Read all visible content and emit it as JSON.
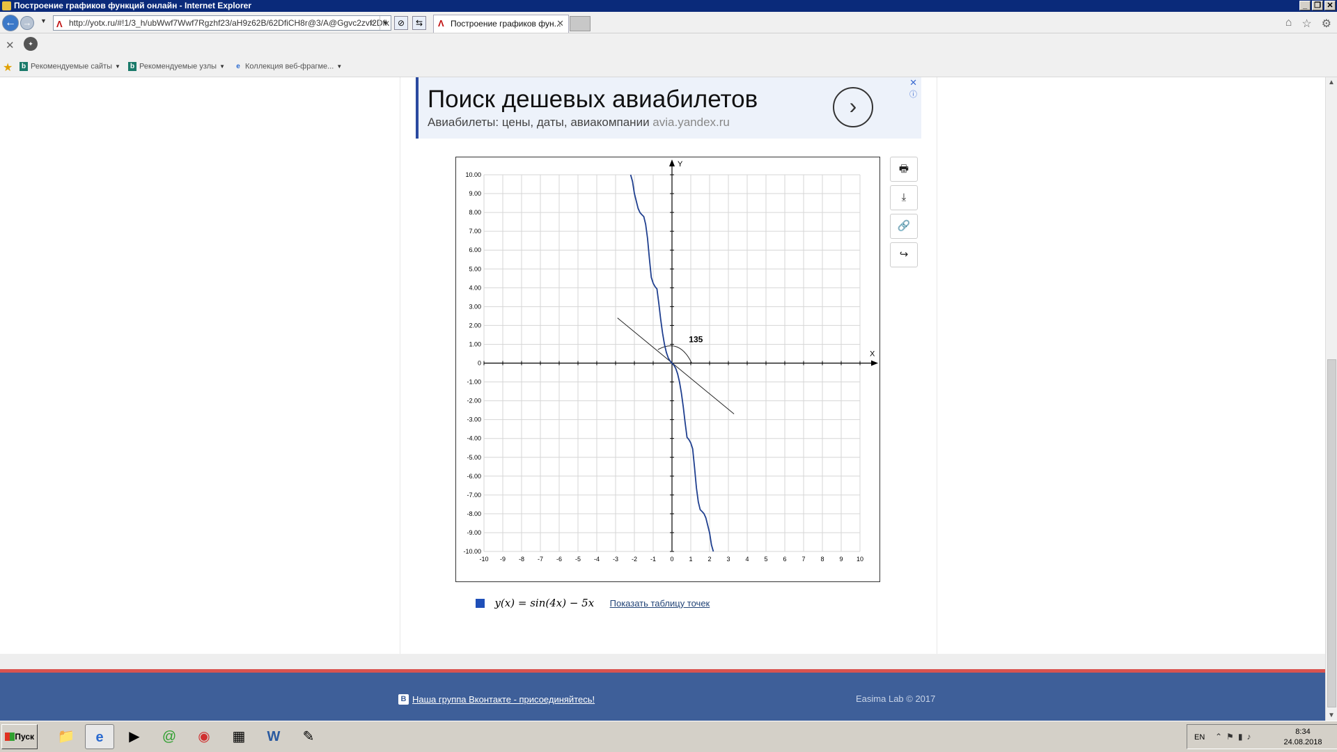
{
  "window": {
    "title": "Построение графиков функций онлайн - Internet Explorer"
  },
  "browser": {
    "address": "http://yotx.ru/#!1/3_h/ubWwf7Wwf7Rgzhf23/aH9z62B/62DfiCH8r@3/A@Ggvc2zvf2Dfk",
    "tab_label": "Построение графиков фун...",
    "favorites": [
      "Рекомендуемые сайты",
      "Рекомендуемые узлы",
      "Коллекция веб-фрагме..."
    ]
  },
  "ad": {
    "headline": "Поиск дешевых авиабилетов",
    "subline": "Авиабилеты: цены, даты, авиакомпании ",
    "domain": "avia.yandex.ru"
  },
  "chart_data": {
    "type": "line",
    "xlabel": "X",
    "ylabel": "Y",
    "xlim": [
      -10,
      10
    ],
    "ylim": [
      -10,
      10
    ],
    "grid": true,
    "x_ticks": [
      "-10",
      "-9",
      "-8",
      "-7",
      "-6",
      "-5",
      "-4",
      "-3",
      "-2",
      "-1",
      "0",
      "1",
      "2",
      "3",
      "4",
      "5",
      "6",
      "7",
      "8",
      "9",
      "10"
    ],
    "y_ticks": [
      "10.00",
      "9.00",
      "8.00",
      "7.00",
      "6.00",
      "5.00",
      "4.00",
      "3.00",
      "2.00",
      "1.00",
      "0",
      "-1.00",
      "-2.00",
      "-3.00",
      "-4.00",
      "-5.00",
      "-6.00",
      "-7.00",
      "-8.00",
      "-9.00",
      "-10.00"
    ],
    "series": [
      {
        "name": "y(x) = sin(4x) − 5x",
        "color": "#1f3f8f",
        "x": [
          -2.2,
          -2.1,
          -2.0,
          -1.9,
          -1.8,
          -1.7,
          -1.6,
          -1.5,
          -1.4,
          -1.3,
          -1.2,
          -1.1,
          -1.0,
          -0.9,
          -0.8,
          -0.7,
          -0.6,
          -0.5,
          -0.4,
          -0.3,
          -0.2,
          -0.1,
          0.0,
          0.1,
          0.2,
          0.3,
          0.4,
          0.5,
          0.6,
          0.7,
          0.8,
          0.9,
          1.0,
          1.1,
          1.2,
          1.3,
          1.4,
          1.5,
          1.6,
          1.7,
          1.8,
          1.9,
          2.0,
          2.1,
          2.2
        ],
        "y": [
          10.4,
          9.65,
          9.01,
          8.61,
          8.21,
          7.99,
          7.88,
          7.78,
          7.37,
          6.62,
          5.54,
          4.55,
          4.24,
          4.06,
          3.94,
          3.17,
          2.32,
          1.59,
          1.0,
          0.57,
          0.28,
          0.11,
          0,
          -0.11,
          -0.28,
          -0.57,
          -1.0,
          -1.59,
          -2.32,
          -3.17,
          -3.94,
          -4.06,
          -4.24,
          -4.55,
          -5.54,
          -6.62,
          -7.37,
          -7.78,
          -7.88,
          -7.99,
          -8.21,
          -8.61,
          -9.01,
          -9.65,
          -10.4
        ]
      }
    ],
    "annotation": {
      "label": "135",
      "tangent_line": {
        "x": [
          -2.9,
          3.3
        ],
        "y": [
          2.4,
          -2.7
        ]
      }
    }
  },
  "toolbar": {
    "icons": [
      "print-icon",
      "download-icon",
      "link-icon",
      "share-icon"
    ]
  },
  "legend": {
    "formula": "y(x) = sin(4x) − 5x",
    "color": "#1f4fb8",
    "link": "Показать таблицу точек"
  },
  "footer": {
    "vk": "Наша группа Вконтакте - присоединяйтесь!",
    "copyright": "Easima Lab © 2017"
  },
  "taskbar": {
    "start": "Пуск",
    "lang": "EN",
    "time": "8:34",
    "date": "24.08.2018"
  }
}
